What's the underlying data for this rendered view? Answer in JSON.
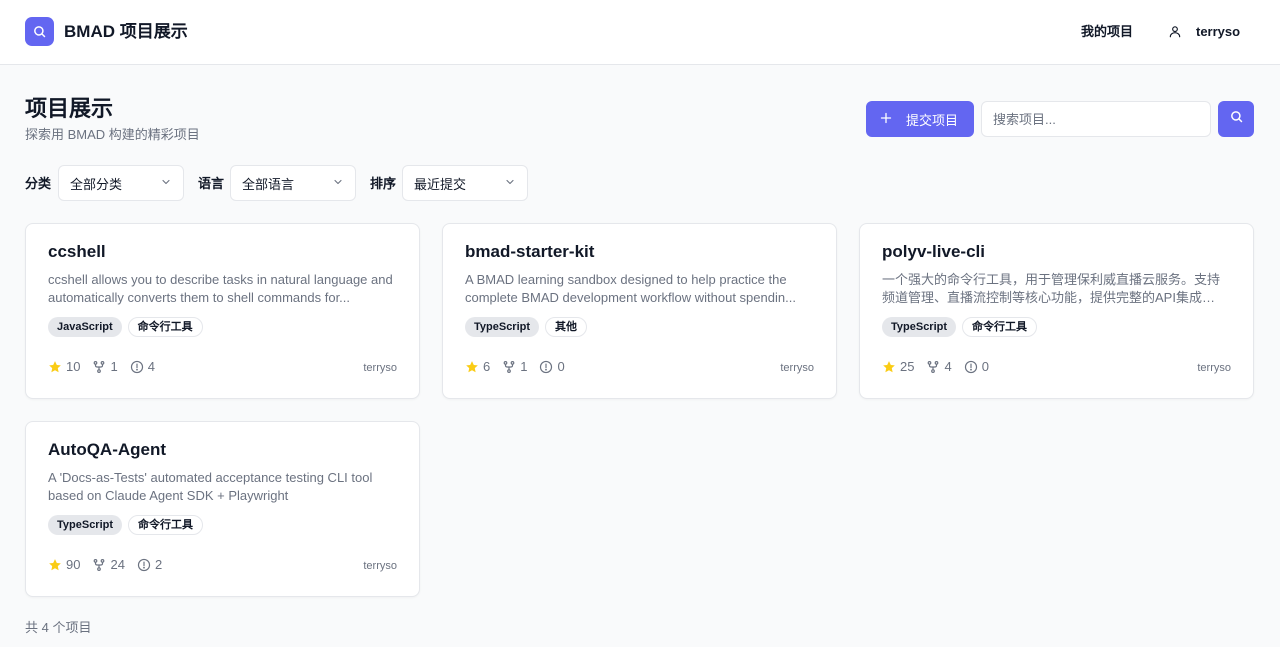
{
  "header": {
    "app_title": "BMAD 项目展示",
    "nav_my_projects": "我的项目",
    "user_name": "terryso"
  },
  "page": {
    "title": "项目展示",
    "subtitle": "探索用 BMAD 构建的精彩项目",
    "submit_label": "提交项目",
    "search_placeholder": "搜索项目..."
  },
  "filters": {
    "category_label": "分类",
    "category_value": "全部分类",
    "language_label": "语言",
    "language_value": "全部语言",
    "sort_label": "排序",
    "sort_value": "最近提交"
  },
  "projects": [
    {
      "name": "ccshell",
      "description": "ccshell allows you to describe tasks in natural language and automatically converts them to shell commands for...",
      "language": "JavaScript",
      "category": "命令行工具",
      "stars": "10",
      "forks": "1",
      "issues": "4",
      "author": "terryso"
    },
    {
      "name": "bmad-starter-kit",
      "description": "A BMAD learning sandbox designed to help practice the complete BMAD development workflow without spendin...",
      "language": "TypeScript",
      "category": "其他",
      "stars": "6",
      "forks": "1",
      "issues": "0",
      "author": "terryso"
    },
    {
      "name": "polyv-live-cli",
      "description": "一个强大的命令行工具，用于管理保利威直播云服务。支持频道管理、直播流控制等核心功能，提供完整的API集成和友好...",
      "language": "TypeScript",
      "category": "命令行工具",
      "stars": "25",
      "forks": "4",
      "issues": "0",
      "author": "terryso"
    },
    {
      "name": "AutoQA-Agent",
      "description": "A 'Docs-as-Tests' automated acceptance testing CLI tool based on Claude Agent SDK + Playwright",
      "language": "TypeScript",
      "category": "命令行工具",
      "stars": "90",
      "forks": "24",
      "issues": "2",
      "author": "terryso"
    }
  ],
  "footer": {
    "total": "共 4 个项目"
  },
  "colors": {
    "accent": "#6366f1",
    "star": "#facc15"
  },
  "icons": [
    "search-icon",
    "user-icon",
    "plus-icon",
    "chevron-down-icon",
    "star-icon",
    "fork-icon",
    "issue-icon"
  ]
}
